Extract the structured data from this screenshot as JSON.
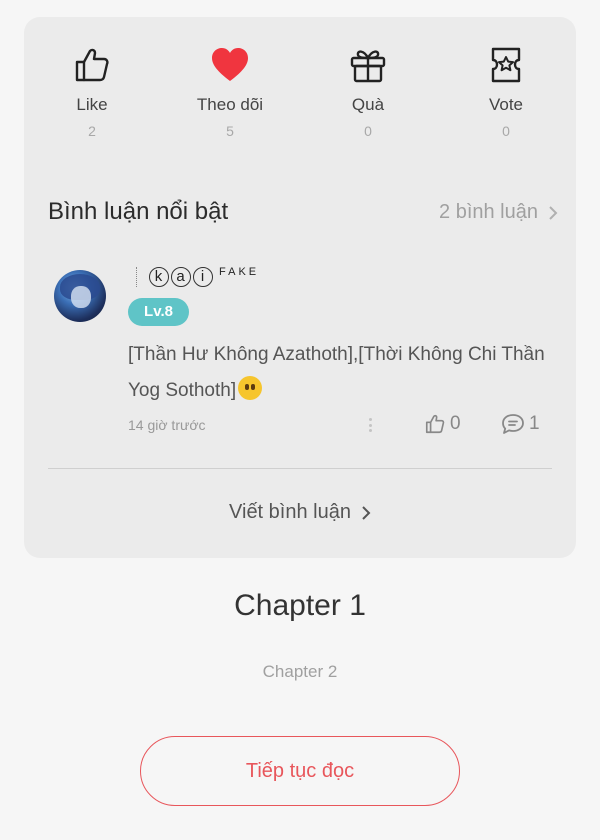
{
  "stats": [
    {
      "label": "Like",
      "count": "2",
      "icon": "thumbs-up-icon"
    },
    {
      "label": "Theo dõi",
      "count": "5",
      "icon": "heart-icon"
    },
    {
      "label": "Quà",
      "count": "0",
      "icon": "gift-icon"
    },
    {
      "label": "Vote",
      "count": "0",
      "icon": "ticket-star-icon"
    }
  ],
  "comments_section": {
    "title": "Bình luận nổi bật",
    "count_label": "2 bình luận"
  },
  "comment": {
    "username_circled": [
      "k",
      "a",
      "i"
    ],
    "username_suffix": "FAKE",
    "level": "Lv.8",
    "text": "[Thần Hư Không Azathoth],[Thời Không Chi Thần Yog Sothoth]",
    "time": "14 giờ trước",
    "likes": "0",
    "replies": "1"
  },
  "write_comment_label": "Viết bình luận",
  "chapter": {
    "title": "Chapter 1",
    "subtitle": "Chapter 2"
  },
  "continue_label": "Tiếp tục đọc",
  "colors": {
    "accent": "#e8565b",
    "heart": "#f0353f",
    "level_badge": "#5fc4c7"
  }
}
